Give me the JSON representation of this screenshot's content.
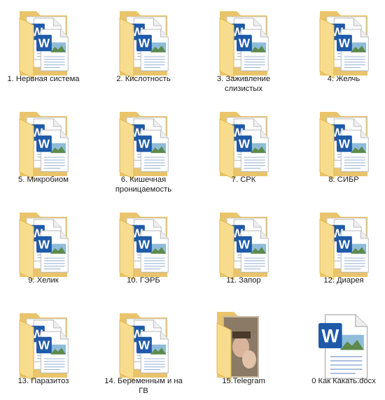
{
  "explorer": {
    "items": [
      {
        "label": "1. Нервная система",
        "type": "folder",
        "icon": "folder-with-word-docs-icon"
      },
      {
        "label": "2. Кислотность",
        "type": "folder",
        "icon": "folder-with-word-docs-icon"
      },
      {
        "label": "3. Заживление слизистых",
        "type": "folder",
        "icon": "folder-with-word-docs-icon"
      },
      {
        "label": "4. Желчь",
        "type": "folder",
        "icon": "folder-with-word-docs-icon"
      },
      {
        "label": "5. Микробиом",
        "type": "folder",
        "icon": "folder-with-word-docs-icon"
      },
      {
        "label": "6. Кишечная проницаемость",
        "type": "folder",
        "icon": "folder-with-word-docs-icon"
      },
      {
        "label": "7. СРК",
        "type": "folder",
        "icon": "folder-with-word-docs-icon"
      },
      {
        "label": "8. СИБР",
        "type": "folder",
        "icon": "folder-with-word-docs-icon"
      },
      {
        "label": "9. Хелик",
        "type": "folder",
        "icon": "folder-with-word-docs-icon"
      },
      {
        "label": "10. ГЭРБ",
        "type": "folder",
        "icon": "folder-with-word-docs-icon"
      },
      {
        "label": "11. Запор",
        "type": "folder",
        "icon": "folder-with-word-docs-icon"
      },
      {
        "label": "12. Диарея",
        "type": "folder",
        "icon": "folder-with-word-docs-icon"
      },
      {
        "label": "13. Паразитоз",
        "type": "folder",
        "icon": "folder-with-word-docs-icon"
      },
      {
        "label": "14. Беременным и на ГВ",
        "type": "folder",
        "icon": "folder-with-word-docs-icon"
      },
      {
        "label": "15.Telegram",
        "type": "folder",
        "icon": "folder-with-photo-icon"
      },
      {
        "label": "0 Как Какать.docx",
        "type": "docx",
        "icon": "word-document-icon"
      }
    ]
  },
  "colors": {
    "folder_back": "#e9c46a",
    "folder_front": "#f8dc8e",
    "word_blue": "#1e5aa8",
    "selection": "#cce8ff"
  }
}
